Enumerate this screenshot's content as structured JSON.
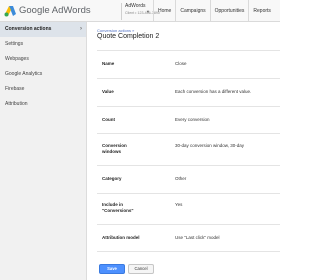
{
  "header": {
    "logo_text": "Google AdWords",
    "account_name": "AdWords",
    "account_sub": "Client • 123-456-7890",
    "nav": [
      "Home",
      "Campaigns",
      "Opportunities",
      "Reports"
    ]
  },
  "sidebar": {
    "items": [
      {
        "label": "Conversion actions",
        "active": true
      },
      {
        "label": "Settings"
      },
      {
        "label": "Webpages"
      },
      {
        "label": "Google Analytics"
      },
      {
        "label": "Firebase"
      },
      {
        "label": "Attribution"
      }
    ]
  },
  "main": {
    "breadcrumb": "Conversion actions »",
    "title": "Quote Completion 2",
    "rows": [
      {
        "label": "Name",
        "value": "Close"
      },
      {
        "label": "Value",
        "value": "Each conversion has a different value."
      },
      {
        "label": "Count",
        "value": "Every conversion"
      },
      {
        "label": "Conversion windows",
        "value": "30-day conversion window, 30-day"
      },
      {
        "label": "Category",
        "value": "Other"
      },
      {
        "label": "Include in \"Conversions\"",
        "value": "Yes"
      },
      {
        "label": "Attribution model",
        "value": "Use \"Last click\" model"
      }
    ]
  },
  "actions": {
    "save_label": "Save",
    "cancel_label": "Cancel"
  },
  "colors": {
    "accent": "#4d90fe",
    "sidebar_active": "#dde3ea",
    "link": "#4f70c5"
  }
}
